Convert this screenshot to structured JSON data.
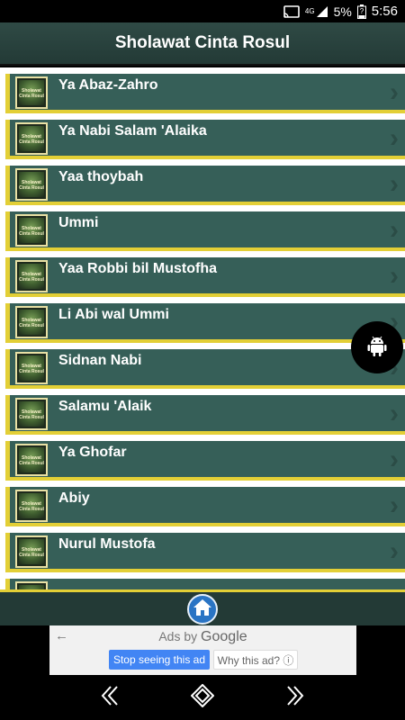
{
  "status_bar": {
    "network": "4G",
    "battery": "5%",
    "time": "5:56"
  },
  "app_bar": {
    "title": "Sholawat Cinta Rosul"
  },
  "list": {
    "thumb_text": "Sholawat Cinta Rosul",
    "items": [
      {
        "label": "Ya Abaz-Zahro"
      },
      {
        "label": "Ya Nabi Salam 'Alaika"
      },
      {
        "label": "Yaa thoybah"
      },
      {
        "label": "Ummi"
      },
      {
        "label": "Yaa Robbi bil Mustofha"
      },
      {
        "label": "Li Abi wal Ummi"
      },
      {
        "label": "Sidnan Nabi"
      },
      {
        "label": "Salamu 'Alaik"
      },
      {
        "label": "Ya Ghofar"
      },
      {
        "label": "Abiy"
      },
      {
        "label": "Nurul Mustofa"
      },
      {
        "label": ""
      }
    ]
  },
  "ad": {
    "title_prefix": "Ads by",
    "title_brand": "Google",
    "stop_label": "Stop seeing this ad",
    "why_label": "Why this ad? ⓘ"
  },
  "colors": {
    "item_bg": "#365f58",
    "accent": "#e3cf36",
    "app_bar": "#233a36",
    "home_button": "#2a74c4"
  }
}
